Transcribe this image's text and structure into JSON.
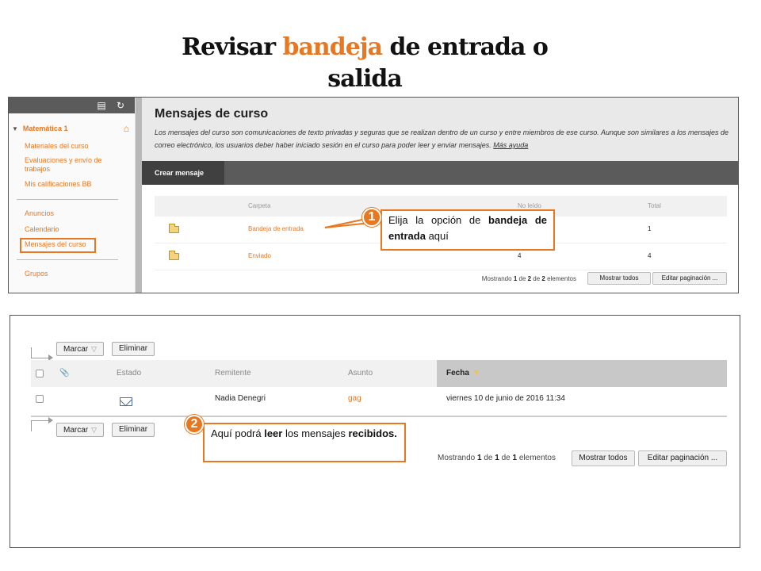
{
  "title": {
    "part1": "Revisar ",
    "accent": "bandeja",
    "part2": " de entrada o salida"
  },
  "colors": {
    "accent": "#e87722",
    "dark_bar": "#5b5b5b"
  },
  "panel1": {
    "sidebar": {
      "course": "Matemática 1",
      "items": [
        "Materiales del curso",
        "Evaluaciones y envío de trabajos",
        "Mis calificaciones BB",
        "Anuncios",
        "Calendario",
        "Mensajes del curso",
        "Grupos"
      ]
    },
    "header": {
      "title": "Mensajes de curso",
      "description": "Los mensajes del curso son comunicaciones de texto privadas y seguras que se realizan dentro de un curso y entre miembros de ese curso. Aunque son similares a los mensajes de correo electrónico, los usuarios deber haber iniciado sesión en el curso para poder leer y enviar mensajes.",
      "help_link": "Más ayuda"
    },
    "action_button": "Crear mensaje",
    "table": {
      "columns": [
        "Carpeta",
        "No leído",
        "Total"
      ],
      "rows": [
        {
          "folder": "Bandeja de entrada",
          "unread": "",
          "total": "1"
        },
        {
          "folder": "Enviado",
          "unread": "4",
          "total": "4"
        }
      ]
    },
    "pager": {
      "prefix": "Mostrando ",
      "from": "1",
      "mid": " de ",
      "to": "2",
      "mid2": " de ",
      "count": "2",
      "suffix": " elementos",
      "show_all": "Mostrar todos",
      "edit_paging": "Editar paginación ..."
    },
    "callout": {
      "number": "1",
      "text1": "Elija la opción de ",
      "bold1": "bandeja de entrada",
      "text2": " aquí"
    }
  },
  "panel2": {
    "toolbar": {
      "mark": "Marcar",
      "delete": "Eliminar"
    },
    "columns": {
      "status": "Estado",
      "sender": "Remitente",
      "subject": "Asunto",
      "date": "Fecha"
    },
    "row": {
      "sender": "Nadia Denegri",
      "subject": "gag",
      "date": "viernes 10 de junio de 2016 11:34"
    },
    "pager": {
      "prefix": "Mostrando ",
      "from": "1",
      "mid": " de ",
      "to": "1",
      "mid2": " de ",
      "count": "1",
      "suffix": " elementos",
      "show_all": "Mostrar todos",
      "edit_paging": "Editar paginación ..."
    },
    "callout": {
      "number": "2",
      "text1": "Aquí podrá ",
      "bold1": "leer",
      "text2": " los mensajes ",
      "bold2": "recibidos."
    }
  }
}
